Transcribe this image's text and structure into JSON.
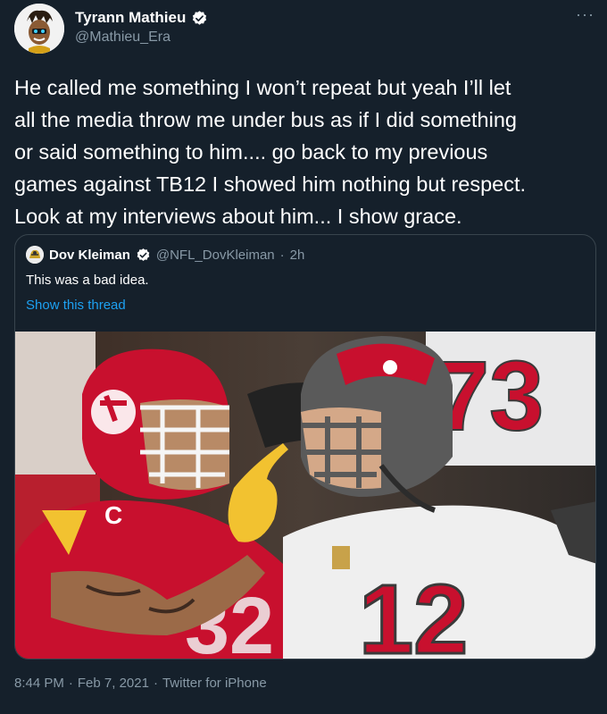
{
  "author": {
    "name": "Tyrann Mathieu",
    "handle": "@Mathieu_Era",
    "verified": true,
    "avatar_icon": "cartoon-portrait-avatar"
  },
  "more_label": "···",
  "tweet": {
    "text": "He called me something I won’t repeat but yeah I’ll let\nall the media throw me under bus as if I did something\nor said something to him.... go back to my previous\ngames against TB12 I showed him nothing but respect.\nLook at my interviews about him... I show grace."
  },
  "quoted": {
    "name": "Dov Kleiman",
    "handle": "@NFL_DovKleiman",
    "separator": "·",
    "time": "2h",
    "text": "This was a bad idea.",
    "show_thread": "Show this thread",
    "media": {
      "description_icon": "football-players-photo",
      "left_jersey_number": "32",
      "right_jersey_number": "12",
      "background_jersey_number": "73"
    }
  },
  "footer": {
    "time": "8:44 PM",
    "sep1": "·",
    "date": "Feb 7, 2021",
    "sep2": "·",
    "source": "Twitter for iPhone"
  },
  "colors": {
    "background": "#15202b",
    "secondary_text": "#8899a6",
    "link": "#1da1f2",
    "verified": "#ffffff",
    "chiefs_red": "#c8102e",
    "bucs_pewter": "#5a5a5a"
  }
}
